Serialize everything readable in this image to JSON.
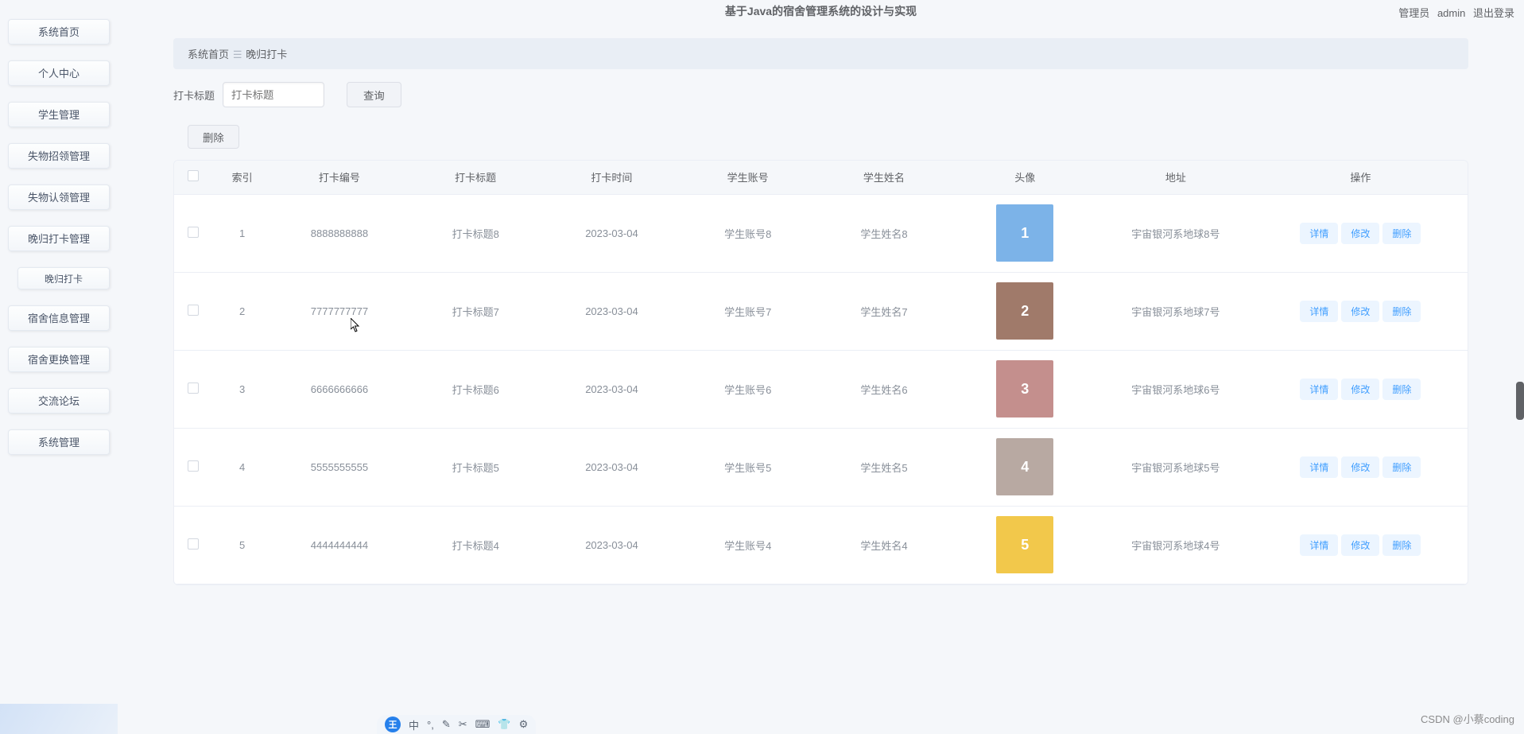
{
  "app": {
    "title": "基于Java的宿舍管理系统的设计与实现"
  },
  "user": {
    "role_label": "管理员",
    "name": "admin",
    "logout_label": "退出登录"
  },
  "sidebar": {
    "items": [
      {
        "label": "系统首页"
      },
      {
        "label": "个人中心"
      },
      {
        "label": "学生管理"
      },
      {
        "label": "失物招领管理"
      },
      {
        "label": "失物认领管理"
      },
      {
        "label": "晚归打卡管理"
      },
      {
        "label": "宿舍信息管理"
      },
      {
        "label": "宿舍更换管理"
      },
      {
        "label": "交流论坛"
      },
      {
        "label": "系统管理"
      }
    ],
    "sub": {
      "label": "晚归打卡"
    }
  },
  "breadcrumb": {
    "home": "系统首页",
    "sep_glyph": "☰",
    "current": "晚归打卡"
  },
  "filter": {
    "label": "打卡标题",
    "placeholder": "打卡标题",
    "query_btn": "查询",
    "delete_btn": "删除"
  },
  "table": {
    "headers": {
      "index": "索引",
      "code": "打卡编号",
      "title": "打卡标题",
      "time": "打卡时间",
      "account": "学生账号",
      "name": "学生姓名",
      "avatar": "头像",
      "address": "地址",
      "actions": "操作"
    },
    "action_labels": {
      "detail": "详情",
      "edit": "修改",
      "delete": "删除"
    },
    "rows": [
      {
        "index": "1",
        "code": "8888888888",
        "title": "打卡标题8",
        "time": "2023-03-04",
        "account": "学生账号8",
        "name": "学生姓名8",
        "address": "宇宙银河系地球8号",
        "avatar_color": "#7cb3e8"
      },
      {
        "index": "2",
        "code": "7777777777",
        "title": "打卡标题7",
        "time": "2023-03-04",
        "account": "学生账号7",
        "name": "学生姓名7",
        "address": "宇宙银河系地球7号",
        "avatar_color": "#a07a6a"
      },
      {
        "index": "3",
        "code": "6666666666",
        "title": "打卡标题6",
        "time": "2023-03-04",
        "account": "学生账号6",
        "name": "学生姓名6",
        "address": "宇宙银河系地球6号",
        "avatar_color": "#c48f8d"
      },
      {
        "index": "4",
        "code": "5555555555",
        "title": "打卡标题5",
        "time": "2023-03-04",
        "account": "学生账号5",
        "name": "学生姓名5",
        "address": "宇宙银河系地球5号",
        "avatar_color": "#b8a9a2"
      },
      {
        "index": "5",
        "code": "4444444444",
        "title": "打卡标题4",
        "time": "2023-03-04",
        "account": "学生账号4",
        "name": "学生姓名4",
        "address": "宇宙银河系地球4号",
        "avatar_color": "#f2c84b"
      }
    ]
  },
  "watermark": {
    "text": "CSDN @小蔡coding"
  },
  "ime": {
    "logo": "王",
    "mode": "中",
    "icons": [
      "°,",
      "✎",
      "✂",
      "⌨",
      "👕",
      "⚙"
    ]
  }
}
